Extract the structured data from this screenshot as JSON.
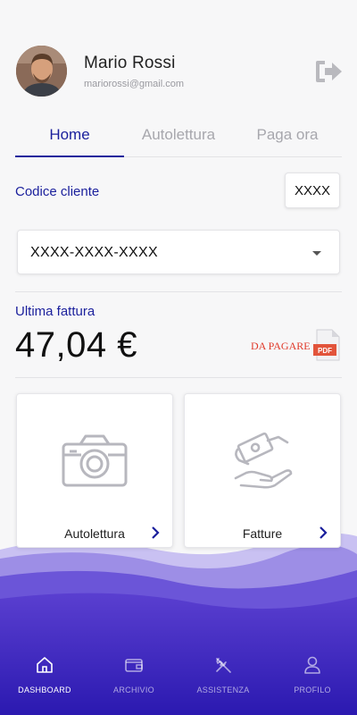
{
  "user": {
    "name": "Mario Rossi",
    "email": "mariorossi@gmail.com"
  },
  "tabs": [
    {
      "label": "Home",
      "active": true
    },
    {
      "label": "Autolettura",
      "active": false
    },
    {
      "label": "Paga ora",
      "active": false
    }
  ],
  "codice": {
    "label": "Codice cliente",
    "value": "XXXX"
  },
  "contract_select": {
    "value": "XXXX-XXXX-XXXX"
  },
  "invoice": {
    "label": "Ultima fattura",
    "amount": "47,04  €",
    "status": "DA PAGARE",
    "pdf_label": "PDF"
  },
  "cards": [
    {
      "label": "Autolettura",
      "icon": "camera-icon"
    },
    {
      "label": "Fatture",
      "icon": "money-hand-icon"
    }
  ],
  "bottom_nav": [
    {
      "label": "DASHBOARD",
      "icon": "home-icon",
      "active": true
    },
    {
      "label": "ARCHIVIO",
      "icon": "wallet-icon",
      "active": false
    },
    {
      "label": "ASSISTENZA",
      "icon": "tools-icon",
      "active": false
    },
    {
      "label": "PROFILO",
      "icon": "user-icon",
      "active": false
    }
  ],
  "colors": {
    "accent": "#1a1f9c",
    "alert": "#e03a2a",
    "wave_dark": "#3a1fb8",
    "wave_light": "#8a7ae0"
  }
}
